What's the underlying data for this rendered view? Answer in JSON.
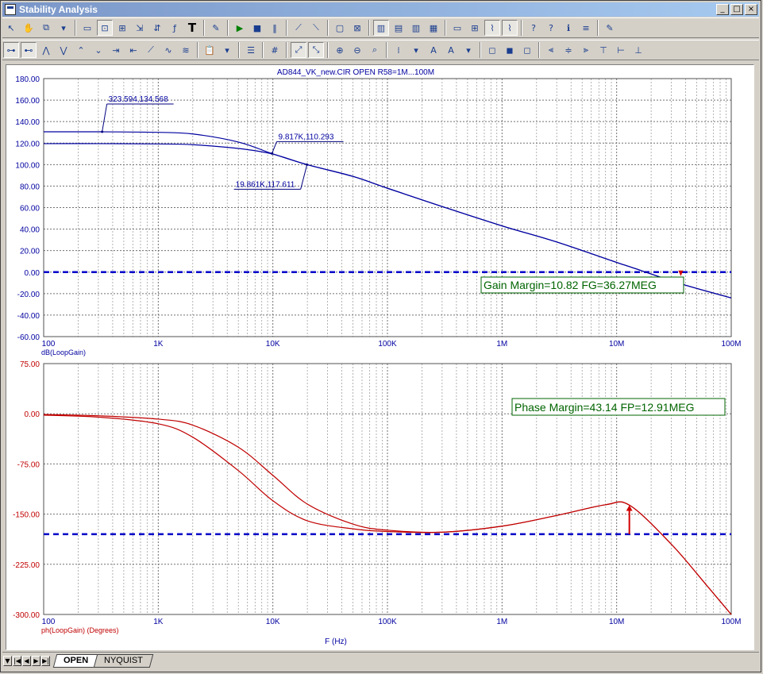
{
  "window": {
    "title": "Stability Analysis",
    "min_label": "_",
    "max_label": "□",
    "close_label": "×"
  },
  "toolbar1": [
    {
      "icon": "pointer-icon"
    },
    {
      "icon": "hand-icon"
    },
    {
      "icon": "copy-icon"
    },
    {
      "icon": "dropdown-icon"
    },
    {
      "icon": "sep"
    },
    {
      "icon": "image-icon"
    },
    {
      "icon": "scale-icon"
    },
    {
      "icon": "zoom-fit-icon"
    },
    {
      "icon": "cursor-select-icon"
    },
    {
      "icon": "cursor-move-icon"
    },
    {
      "icon": "function-icon"
    },
    {
      "icon": "text-icon",
      "label": "T"
    },
    {
      "icon": "sep"
    },
    {
      "icon": "properties-icon"
    },
    {
      "icon": "sep"
    },
    {
      "icon": "run-icon"
    },
    {
      "icon": "stop-icon"
    },
    {
      "icon": "pause-icon"
    },
    {
      "icon": "sep"
    },
    {
      "icon": "peak-icon"
    },
    {
      "icon": "valley-icon"
    },
    {
      "icon": "sep"
    },
    {
      "icon": "frame-icon"
    },
    {
      "icon": "grid-icon"
    },
    {
      "icon": "sep"
    },
    {
      "icon": "layout1-icon"
    },
    {
      "icon": "layout2-icon"
    },
    {
      "icon": "layout3-icon"
    },
    {
      "icon": "layout4-icon"
    },
    {
      "icon": "sep"
    },
    {
      "icon": "h-line-icon"
    },
    {
      "icon": "h-grid-icon"
    },
    {
      "icon": "plot-icon"
    },
    {
      "icon": "plot-mark-icon"
    },
    {
      "icon": "sep"
    },
    {
      "icon": "help-icon"
    },
    {
      "icon": "help2-icon"
    },
    {
      "icon": "info-icon"
    },
    {
      "icon": "stack-icon"
    },
    {
      "icon": "sep"
    },
    {
      "icon": "edit-icon"
    }
  ],
  "toolbar2": [
    {
      "icon": "cursor-h-icon"
    },
    {
      "icon": "cursor-h2-icon"
    },
    {
      "icon": "peak-find-icon"
    },
    {
      "icon": "valley-find-icon"
    },
    {
      "icon": "high-icon"
    },
    {
      "icon": "low-icon"
    },
    {
      "icon": "next-icon"
    },
    {
      "icon": "prev-icon"
    },
    {
      "icon": "slope-icon"
    },
    {
      "icon": "wave-icon"
    },
    {
      "icon": "wave2-icon"
    },
    {
      "icon": "sep"
    },
    {
      "icon": "clipboard-icon"
    },
    {
      "icon": "dropdown-icon"
    },
    {
      "icon": "sep"
    },
    {
      "icon": "list-icon"
    },
    {
      "icon": "sep"
    },
    {
      "icon": "numbers-icon"
    },
    {
      "icon": "sep"
    },
    {
      "icon": "fit-icon"
    },
    {
      "icon": "fit2-icon"
    },
    {
      "icon": "sep"
    },
    {
      "icon": "zoom-in-icon"
    },
    {
      "icon": "zoom-out-icon"
    },
    {
      "icon": "zoom-region-icon"
    },
    {
      "icon": "sep"
    },
    {
      "icon": "grid-dots-icon"
    },
    {
      "icon": "dropdown-icon"
    },
    {
      "icon": "font-icon",
      "label": "A"
    },
    {
      "icon": "font-size-icon",
      "label": "A"
    },
    {
      "icon": "dropdown-icon"
    },
    {
      "icon": "sep"
    },
    {
      "icon": "shape-icon"
    },
    {
      "icon": "shape2-icon"
    },
    {
      "icon": "shape3-icon"
    },
    {
      "icon": "sep"
    },
    {
      "icon": "align-left-icon"
    },
    {
      "icon": "align-center-icon"
    },
    {
      "icon": "align-right-icon"
    },
    {
      "icon": "align-top-icon"
    },
    {
      "icon": "align-middle-icon"
    },
    {
      "icon": "align-bottom-icon"
    }
  ],
  "tabs": [
    {
      "label": "OPEN",
      "active": true
    },
    {
      "label": "NYQUIST",
      "active": false
    }
  ],
  "chart_data": [
    {
      "type": "line",
      "title": "AD844_VK_new.CIR OPEN R58=1M...100M",
      "xlabel": "",
      "ylabel": "dB(LoopGain)",
      "xscale": "log",
      "xlim": [
        100,
        100000000
      ],
      "ylim": [
        -60,
        180
      ],
      "xticks": [
        "100",
        "1K",
        "10K",
        "100K",
        "1M",
        "10M",
        "100M"
      ],
      "yticks": [
        "180.00",
        "160.00",
        "140.00",
        "120.00",
        "100.00",
        "80.00",
        "60.00",
        "40.00",
        "20.00",
        "0.00",
        "-20.00",
        "-40.00",
        "-60.00"
      ],
      "grid": true,
      "color": "#0000a0",
      "series": [
        {
          "x": [
            100,
            323.594,
            1000,
            2000,
            5000,
            9817,
            19861,
            50000,
            100000,
            300000,
            1000000,
            3000000,
            10000000,
            13000000,
            36270000,
            100000000
          ],
          "y": [
            130.5,
            130.5,
            130,
            128.5,
            121,
            110.293,
            100,
            89,
            78,
            61,
            43,
            28,
            9,
            5,
            -10.82,
            -24
          ]
        },
        {
          "x": [
            100,
            323.594,
            1000,
            2000,
            5000,
            9817,
            19861,
            50000,
            100000,
            300000,
            1000000,
            3000000,
            10000000,
            13000000,
            36270000,
            100000000
          ],
          "y": [
            119.5,
            119.5,
            119.2,
            118.5,
            115,
            110,
            100,
            89,
            78,
            61,
            43,
            28,
            9,
            5,
            -10.82,
            -24
          ]
        }
      ],
      "reference_line": {
        "y": 0,
        "style": "dashed",
        "color": "#0000c8"
      },
      "labels": [
        {
          "text": "323.594,134.568",
          "x": 323.594,
          "y": 130.5
        },
        {
          "text": "9.817K,110.293",
          "x": 9817,
          "y": 110.293
        },
        {
          "text": "19.861K,117.611",
          "x": 19861,
          "y": 100
        }
      ],
      "annotation": {
        "text": "Gain Margin=10.82 FG=36.27MEG",
        "color": "#006400",
        "marker_x": 36270000
      }
    },
    {
      "type": "line",
      "title": "",
      "xlabel": "F (Hz)",
      "ylabel": "ph(LoopGain) (Degrees)",
      "xscale": "log",
      "xlim": [
        100,
        100000000
      ],
      "ylim": [
        -300,
        75
      ],
      "xticks": [
        "100",
        "1K",
        "10K",
        "100K",
        "1M",
        "10M",
        "100M"
      ],
      "yticks": [
        "75.00",
        "0.00",
        "-75.00",
        "-150.00",
        "-225.00",
        "-300.00"
      ],
      "grid": true,
      "color": "#c00000",
      "series": [
        {
          "x": [
            100,
            300,
            1000,
            2000,
            5000,
            10000,
            20000,
            50000,
            100000,
            300000,
            1000000,
            3000000,
            8000000,
            13000000,
            30000000,
            60000000,
            100000000
          ],
          "y": [
            -2,
            -5,
            -15,
            -35,
            -85,
            -130,
            -160,
            -172,
            -176,
            -177,
            -168,
            -152,
            -136,
            -136.86,
            -195,
            -255,
            -300
          ]
        },
        {
          "x": [
            100,
            300,
            1000,
            2000,
            5000,
            10000,
            20000,
            50000,
            100000,
            300000,
            1000000,
            3000000,
            8000000,
            13000000,
            30000000,
            60000000,
            100000000
          ],
          "y": [
            -1,
            -3,
            -8,
            -17,
            -50,
            -92,
            -135,
            -165,
            -174,
            -177,
            -168,
            -152,
            -136,
            -136.86,
            -195,
            -255,
            -300
          ]
        }
      ],
      "reference_line": {
        "y": -180,
        "style": "dashed",
        "color": "#0000c8"
      },
      "annotation": {
        "text": "Phase Margin=43.14 FP=12.91MEG",
        "color": "#006400",
        "arrow_x": 12910000,
        "arrow_from": -180,
        "arrow_to": -136.86
      }
    }
  ]
}
